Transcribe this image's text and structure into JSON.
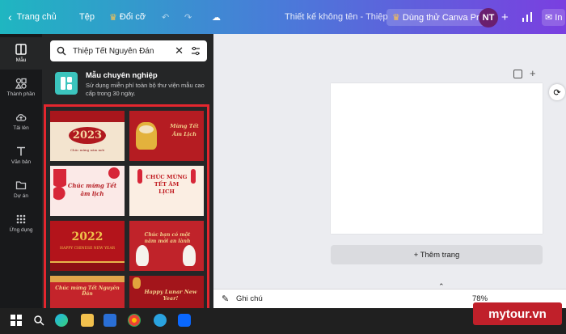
{
  "topbar": {
    "home": "Trang chủ",
    "file": "Tệp",
    "resize": "Đổi cỡ",
    "title": "Thiết kế không tên - Thiệp",
    "pro_cta": "Dùng thử Canva Pro",
    "avatar": "NT",
    "share_partial": "In"
  },
  "rail": {
    "items": [
      {
        "label": "Mẫu",
        "icon": "template-icon"
      },
      {
        "label": "Thành phần",
        "icon": "elements-icon"
      },
      {
        "label": "Tải lên",
        "icon": "upload-cloud-icon"
      },
      {
        "label": "Văn bản",
        "icon": "text-icon"
      },
      {
        "label": "Dự án",
        "icon": "folder-icon"
      },
      {
        "label": "Ứng dụng",
        "icon": "apps-grid-icon"
      }
    ]
  },
  "panel": {
    "search_value": "Thiệp Tết Nguyên Đán",
    "promo_title": "Mẫu chuyên nghiệp",
    "promo_desc": "Sử dụng miễn phí toàn bộ thư viện mẫu cao cấp trong 30 ngày.",
    "templates": [
      {
        "text": "2023",
        "sub": "Chúc mừng năm mới"
      },
      {
        "text": "Mừng Tết Âm Lịch",
        "sub": ""
      },
      {
        "text": "Chúc mừng Tết âm lịch",
        "sub": ""
      },
      {
        "text": "CHÚC MỪNG TẾT ÂM LỊCH",
        "sub": ""
      },
      {
        "text": "2022",
        "sub": "HAPPY CHINESE NEW YEAR"
      },
      {
        "text": "Chúc bạn có một năm mới an lành",
        "sub": ""
      },
      {
        "text": "Chúc mừng Tết Nguyên Đán",
        "sub": ""
      },
      {
        "text": "Happy Lunar New Year!",
        "sub": ""
      }
    ]
  },
  "editor": {
    "add_page": "+ Thêm trang",
    "notes": "Ghi chú",
    "zoom": "78%"
  },
  "watermark": "mytour.vn"
}
